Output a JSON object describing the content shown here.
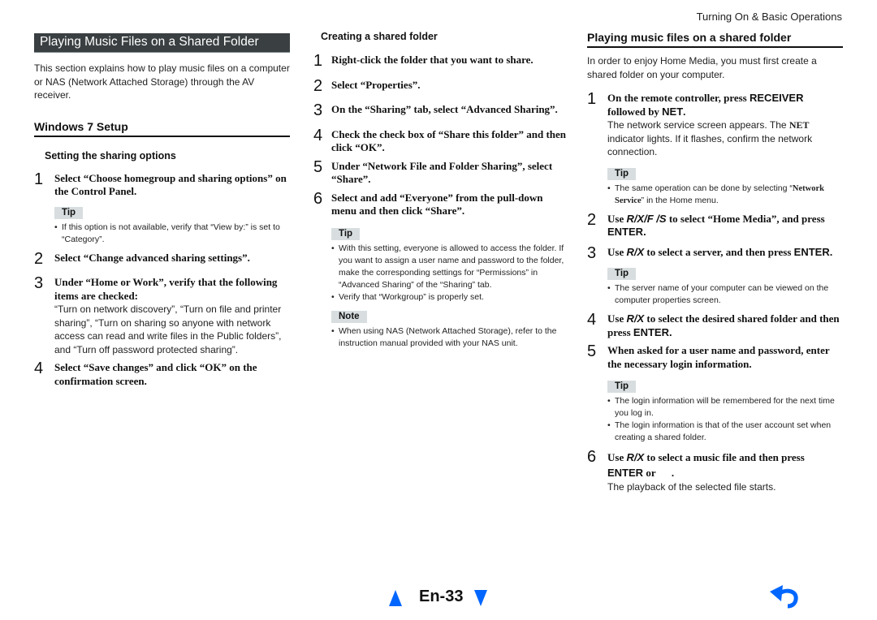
{
  "running_head": "Turning On & Basic Operations",
  "left": {
    "banner": "Playing Music Files on a Shared Folder",
    "intro": "This section explains how to play music files on a computer or NAS (Network Attached Storage) through the AV receiver.",
    "section_title": "Windows 7 Setup",
    "subsection_title": "Setting the sharing options",
    "steps": [
      {
        "num": "1",
        "title": "Select “Choose homegroup and sharing options” on the Control Panel."
      },
      {
        "num": "2",
        "title": "Select “Change advanced sharing settings”."
      },
      {
        "num": "3",
        "title": "Under “Home or Work”, verify that the following items are checked:",
        "body": "“Turn on network discovery”, “Turn on file and printer sharing”, “Turn on sharing so anyone with network access can read and write files in the Public folders”, and “Turn off password protected sharing”."
      },
      {
        "num": "4",
        "title": "Select “Save changes” and click “OK” on the confirmation screen."
      }
    ],
    "tip_label": "Tip",
    "tip1": "If this option is not available, verify that “View by:” is set to “Category”."
  },
  "middle": {
    "subsection_title": "Creating a shared folder",
    "steps": [
      {
        "num": "1",
        "title": "Right-click the folder that you want to share."
      },
      {
        "num": "2",
        "title": "Select “Properties”."
      },
      {
        "num": "3",
        "title": "On the “Sharing” tab, select “Advanced Sharing”."
      },
      {
        "num": "4",
        "title": "Check the check box of “Share this folder” and then click “OK”."
      },
      {
        "num": "5",
        "title": "Under “Network File and Folder Sharing”, select “Share”."
      },
      {
        "num": "6",
        "title": "Select and add “Everyone” from the pull-down menu and then click “Share”."
      }
    ],
    "tip_label": "Tip",
    "tips": [
      "With this setting, everyone is allowed to access the folder. If you want to assign a user name and password to the folder, make the corresponding settings for “Permissions” in “Advanced Sharing” of the “Sharing” tab.",
      "Verify that “Workgroup” is properly set."
    ],
    "note_label": "Note",
    "notes": [
      "When using NAS (Network Attached Storage), refer to the instruction manual provided with your NAS unit."
    ]
  },
  "right": {
    "section_title": "Playing music files on a shared folder",
    "intro": "In order to enjoy Home Media, you must first create a shared folder on your computer.",
    "tip_label": "Tip",
    "step1": {
      "num": "1",
      "a": "On the remote controller, press ",
      "b": "RECEIVER",
      "c": " followed by ",
      "d": "NET",
      "e": ".",
      "body_a": "The network service screen appears. The ",
      "body_b": "NET",
      "body_c": " indicator lights. If it flashes, confirm the network connection."
    },
    "tip1": {
      "a": "The same operation can be done by selecting “",
      "b": "Network Service",
      "c": "” in the Home menu."
    },
    "step2": {
      "num": "2",
      "a": "Use ",
      "keys": "R/X/F /S",
      "b": " to select “Home Media”, and press ",
      "c": "ENTER",
      "d": "."
    },
    "step3": {
      "num": "3",
      "a": "Use ",
      "keys": "R/X",
      "b": " to select a server, and then press ",
      "c": "ENTER",
      "d": "."
    },
    "tip3": "The server name of your computer can be viewed on the computer properties screen.",
    "step4": {
      "num": "4",
      "a": "Use ",
      "keys": "R/X",
      "b": " to select the desired shared folder and then press ",
      "c": "ENTER",
      "d": "."
    },
    "step5": {
      "num": "5",
      "title": "When asked for a user name and password, enter the necessary login information."
    },
    "tips5": [
      "The login information will be remembered for the next time you log in.",
      "The login information is that of the user account set when creating a shared folder."
    ],
    "step6": {
      "num": "6",
      "a": "Use ",
      "keys": "R/X",
      "b": " to select a music file and then press ",
      "c": "ENTER",
      "d": " or      .",
      "body": "The playback of the selected file starts."
    }
  },
  "footer": {
    "page_label": "En-33",
    "prev_icon": "triangle-up",
    "next_icon": "triangle-down",
    "back_icon": "return-arrow",
    "accent_color": "#0066ff"
  }
}
